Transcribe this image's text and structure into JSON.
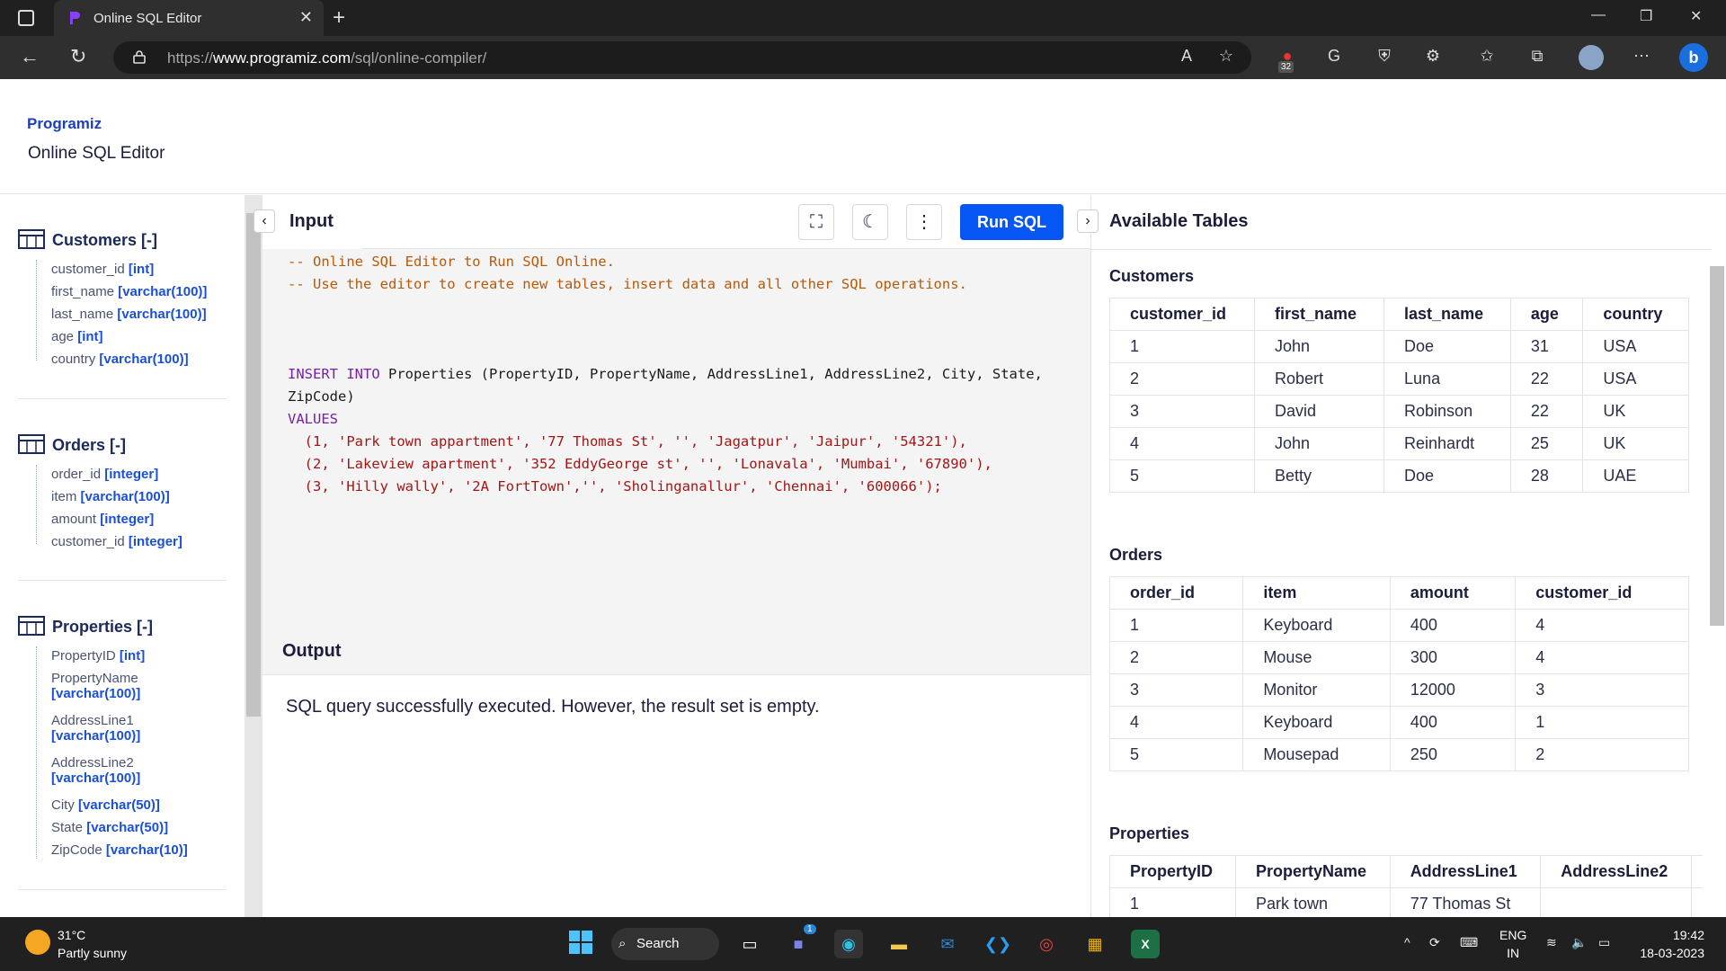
{
  "browser": {
    "tab_title": "Online SQL Editor",
    "url_prefix": "https://",
    "url_host": "www.programiz.com",
    "url_path": "/sql/online-compiler/",
    "extension_badge": "32"
  },
  "header": {
    "brand": "Programiz",
    "subtitle": "Online SQL Editor"
  },
  "sidebar": {
    "tables": [
      {
        "name": "Customers [-]",
        "columns": [
          {
            "name": "customer_id",
            "type": "[int]"
          },
          {
            "name": "first_name",
            "type": "[varchar(100)]"
          },
          {
            "name": "last_name",
            "type": "[varchar(100)]"
          },
          {
            "name": "age",
            "type": "[int]"
          },
          {
            "name": "country",
            "type": "[varchar(100)]"
          }
        ]
      },
      {
        "name": "Orders [-]",
        "columns": [
          {
            "name": "order_id",
            "type": "[integer]"
          },
          {
            "name": "item",
            "type": "[varchar(100)]"
          },
          {
            "name": "amount",
            "type": "[integer]"
          },
          {
            "name": "customer_id",
            "type": "[integer]"
          }
        ]
      },
      {
        "name": "Properties [-]",
        "columns": [
          {
            "name": "PropertyID",
            "type": "[int]"
          },
          {
            "name": "PropertyName",
            "type": "[varchar(100)]"
          },
          {
            "name": "AddressLine1",
            "type": "[varchar(100)]"
          },
          {
            "name": "AddressLine2",
            "type": "[varchar(100)]"
          },
          {
            "name": "City",
            "type": "[varchar(50)]"
          },
          {
            "name": "State",
            "type": "[varchar(50)]"
          },
          {
            "name": "ZipCode",
            "type": "[varchar(10)]"
          }
        ]
      }
    ]
  },
  "editor": {
    "tab_label": "Input",
    "run_label": "Run SQL",
    "comment1": "-- Online SQL Editor to Run SQL Online.",
    "comment2": "-- Use the editor to create new tables, insert data and all other SQL operations.",
    "insert_kw": "INSERT INTO",
    "insert_rest": " Properties (PropertyID, PropertyName, AddressLine1, AddressLine2, City, State,",
    "insert_cont": "ZipCode)",
    "values_kw": "VALUES",
    "row1": "  (1, 'Park town appartment', '77 Thomas St', '', 'Jagatpur', 'Jaipur', '54321'),",
    "row2": "  (2, 'Lakeview apartment', '352 EddyGeorge st', '', 'Lonavala', 'Mumbai', '67890'),",
    "row3": "  (3, 'Hilly wally', '2A FortTown','', 'Sholinganallur', 'Chennai', '600066');"
  },
  "output": {
    "label": "Output",
    "message": "SQL query successfully executed. However, the result set is empty."
  },
  "available": {
    "title": "Available Tables",
    "customers": {
      "name": "Customers",
      "headers": [
        "customer_id",
        "first_name",
        "last_name",
        "age",
        "country"
      ],
      "rows": [
        [
          "1",
          "John",
          "Doe",
          "31",
          "USA"
        ],
        [
          "2",
          "Robert",
          "Luna",
          "22",
          "USA"
        ],
        [
          "3",
          "David",
          "Robinson",
          "22",
          "UK"
        ],
        [
          "4",
          "John",
          "Reinhardt",
          "25",
          "UK"
        ],
        [
          "5",
          "Betty",
          "Doe",
          "28",
          "UAE"
        ]
      ]
    },
    "orders": {
      "name": "Orders",
      "headers": [
        "order_id",
        "item",
        "amount",
        "customer_id"
      ],
      "rows": [
        [
          "1",
          "Keyboard",
          "400",
          "4"
        ],
        [
          "2",
          "Mouse",
          "300",
          "4"
        ],
        [
          "3",
          "Monitor",
          "12000",
          "3"
        ],
        [
          "4",
          "Keyboard",
          "400",
          "1"
        ],
        [
          "5",
          "Mousepad",
          "250",
          "2"
        ]
      ]
    },
    "properties": {
      "name": "Properties",
      "headers": [
        "PropertyID",
        "PropertyName",
        "AddressLine1",
        "AddressLine2",
        "("
      ],
      "rows": [
        [
          "1",
          "Park town",
          "77 Thomas St",
          "",
          ""
        ]
      ]
    }
  },
  "taskbar": {
    "temp": "31°C",
    "weather": "Partly sunny",
    "search": "Search",
    "lang1": "ENG",
    "lang2": "IN",
    "time": "19:42",
    "date": "18-03-2023",
    "teams_badge": "1"
  }
}
